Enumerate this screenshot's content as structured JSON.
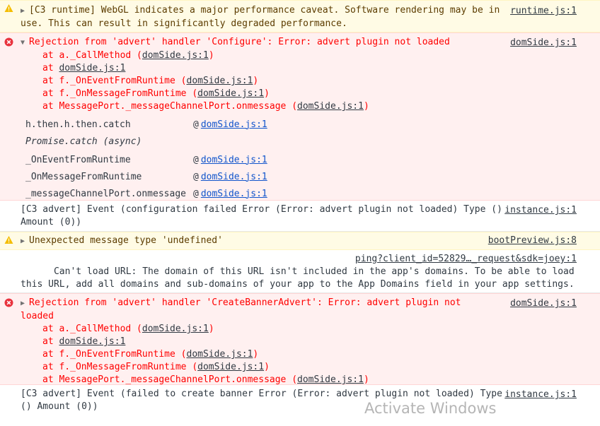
{
  "messages": {
    "m1": {
      "text": "[C3 runtime] WebGL indicates a major performance caveat. Software rendering may be in use. This can result in significantly degraded performance.",
      "source": "runtime.js:1"
    },
    "m2": {
      "text": "Rejection from 'advert' handler 'Configure': Error: advert plugin not loaded",
      "source": "domSide.js:1",
      "frames": [
        {
          "prefix": "at a._CallMethod (",
          "file": "domSide.js:1",
          "suffix": ")"
        },
        {
          "prefix": "at ",
          "file": "domSide.js:1",
          "suffix": ""
        },
        {
          "prefix": "at f._OnEventFromRuntime (",
          "file": "domSide.js:1",
          "suffix": ")"
        },
        {
          "prefix": "at f._OnMessageFromRuntime (",
          "file": "domSide.js:1",
          "suffix": ")"
        },
        {
          "prefix": "at MessagePort._messageChannelPort.onmessage (",
          "file": "domSide.js:1",
          "suffix": ")"
        }
      ],
      "async": [
        {
          "fn": "h.then.h.then.catch",
          "at": "@",
          "link": "domSide.js:1"
        },
        {
          "label": "Promise.catch (async)"
        },
        {
          "fn": "_OnEventFromRuntime",
          "at": "@",
          "link": "domSide.js:1"
        },
        {
          "fn": "_OnMessageFromRuntime",
          "at": "@",
          "link": "domSide.js:1"
        },
        {
          "fn": "_messageChannelPort.onmessage",
          "at": "@",
          "link": "domSide.js:1"
        }
      ]
    },
    "m3": {
      "text": "[C3 advert] Event (configuration failed Error (Error: advert plugin not loaded) Type () Amount (0))",
      "source": "instance.js:1"
    },
    "m4": {
      "text": "Unexpected message type 'undefined'",
      "source": "bootPreview.js:8"
    },
    "m5": {
      "text": "Can't load URL: The domain of this URL isn't included in the app's domains. To be able to load this URL, add all domains and sub-domains of your app to the App Domains field in your app settings.",
      "source": "ping?client_id=52829…_request&sdk=joey:1"
    },
    "m6": {
      "text": "Rejection from 'advert' handler 'CreateBannerAdvert': Error: advert plugin not loaded",
      "source": "domSide.js:1",
      "frames": [
        {
          "prefix": "at a._CallMethod (",
          "file": "domSide.js:1",
          "suffix": ")"
        },
        {
          "prefix": "at ",
          "file": "domSide.js:1",
          "suffix": ""
        },
        {
          "prefix": "at f._OnEventFromRuntime (",
          "file": "domSide.js:1",
          "suffix": ")"
        },
        {
          "prefix": "at f._OnMessageFromRuntime (",
          "file": "domSide.js:1",
          "suffix": ")"
        },
        {
          "prefix": "at MessagePort._messageChannelPort.onmessage (",
          "file": "domSide.js:1",
          "suffix": ")"
        }
      ]
    },
    "m7": {
      "text": "[C3 advert] Event (failed to create banner Error (Error: advert plugin not loaded) Type () Amount (0))",
      "source": "instance.js:1"
    }
  },
  "watermark": "Activate Windows",
  "colors": {
    "warning_bg": "#fffbe5",
    "error_bg": "#fff0f0",
    "error_text": "#ff0000"
  }
}
